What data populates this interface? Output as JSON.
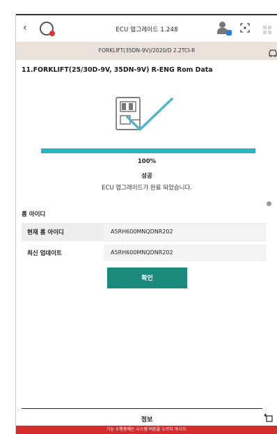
{
  "header": {
    "back_icon": "chevron-left-icon",
    "app_logo": "ecu-logo-icon",
    "title": "ECU 업그레이드 1.248",
    "user_icon": "user-icon",
    "scan_icon": "scan-icon",
    "grid_icon": "grid-icon"
  },
  "vehicle": {
    "label": "FORKLIFT(35DN-9V)/2020/D 2.2TCI-R",
    "icon": "car-icon"
  },
  "rom_heading": "11.FORKLIFT(25/30D-9V, 35DN-9V) R-ENG Rom Data",
  "status": {
    "progress": 100,
    "percent_label": "100%",
    "result": "성공",
    "message": "ECU 업그레이드가 완료 되었습니다."
  },
  "rom_id": {
    "section_title": "롬 아이디",
    "rows": [
      {
        "label": "현재 롬 아이디",
        "value": "A5RH600MNQDNR202"
      },
      {
        "label": "최신 업데이트",
        "value": "A5RH600MNQDNR202"
      }
    ]
  },
  "confirm_label": "확인",
  "footer": {
    "info_label": "정보",
    "exit_icon": "exit-icon",
    "warning": "기능 수행중에는 시스템 버튼을 누르지 마시오."
  },
  "colors": {
    "accent": "#1a8a7d",
    "progress": "#2bb4c0",
    "warning": "#d42c2c",
    "vehicle_bar": "#e9e1da"
  }
}
